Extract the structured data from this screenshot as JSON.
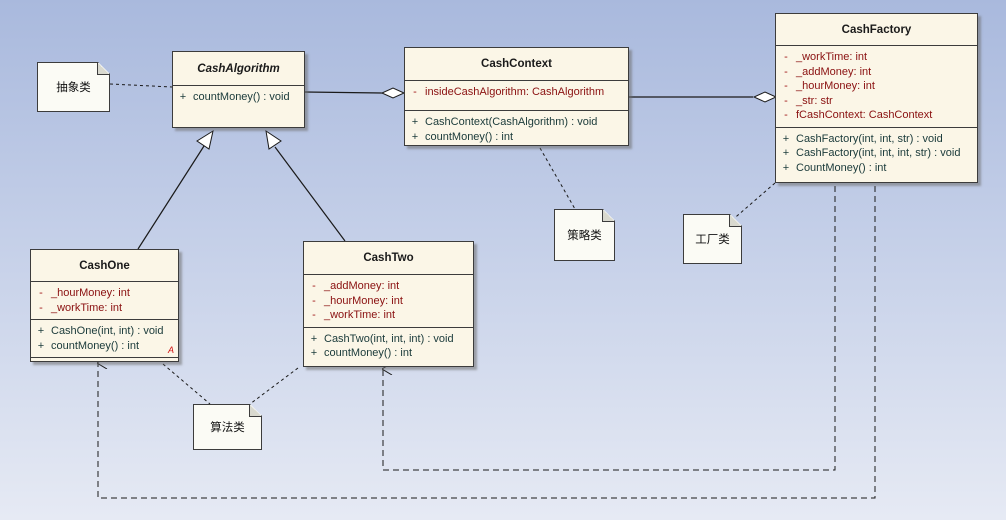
{
  "classes": {
    "cash_algorithm": {
      "name": "CashAlgorithm",
      "operations": [
        {
          "vis": "+",
          "text": "countMoney() : void"
        }
      ]
    },
    "cash_context": {
      "name": "CashContext",
      "attributes": [
        {
          "vis": "-",
          "text": "insideCashAlgorithm:  CashAlgorithm"
        }
      ],
      "operations": [
        {
          "vis": "+",
          "text": "CashContext(CashAlgorithm) : void"
        },
        {
          "vis": "+",
          "text": "countMoney() : int"
        }
      ]
    },
    "cash_factory": {
      "name": "CashFactory",
      "attributes": [
        {
          "vis": "-",
          "text": "_workTime:  int"
        },
        {
          "vis": "-",
          "text": "_addMoney:  int"
        },
        {
          "vis": "-",
          "text": "_hourMoney:  int"
        },
        {
          "vis": "-",
          "text": "_str:  str"
        },
        {
          "vis": "-",
          "text": "fCashContext:  CashContext"
        }
      ],
      "operations": [
        {
          "vis": "+",
          "text": "CashFactory(int, int, str) : void"
        },
        {
          "vis": "+",
          "text": "CashFactory(int, int, int, str) : void"
        },
        {
          "vis": "+",
          "text": "CountMoney() : int"
        }
      ]
    },
    "cash_one": {
      "name": "CashOne",
      "attributes": [
        {
          "vis": "-",
          "text": "_hourMoney:  int"
        },
        {
          "vis": "-",
          "text": "_workTime:  int"
        }
      ],
      "operations": [
        {
          "vis": "+",
          "text": "CashOne(int, int) : void"
        },
        {
          "vis": "+",
          "text": "countMoney() : int"
        }
      ],
      "marker": "A"
    },
    "cash_two": {
      "name": "CashTwo",
      "attributes": [
        {
          "vis": "-",
          "text": "_addMoney:  int"
        },
        {
          "vis": "-",
          "text": "_hourMoney:  int"
        },
        {
          "vis": "-",
          "text": "_workTime:  int"
        }
      ],
      "operations": [
        {
          "vis": "+",
          "text": "CashTwo(int, int, int) : void"
        },
        {
          "vis": "+",
          "text": "countMoney() : int"
        }
      ]
    }
  },
  "notes": {
    "abstract": "抽象类",
    "strategy": "策略类",
    "factory": "工厂类",
    "algorithm": "算法类"
  },
  "colors": {
    "class_fill": "#fbf6e7",
    "attribute_text": "#8a1010",
    "operation_text": "#1a3a3a",
    "line": "#1a1a1a"
  }
}
